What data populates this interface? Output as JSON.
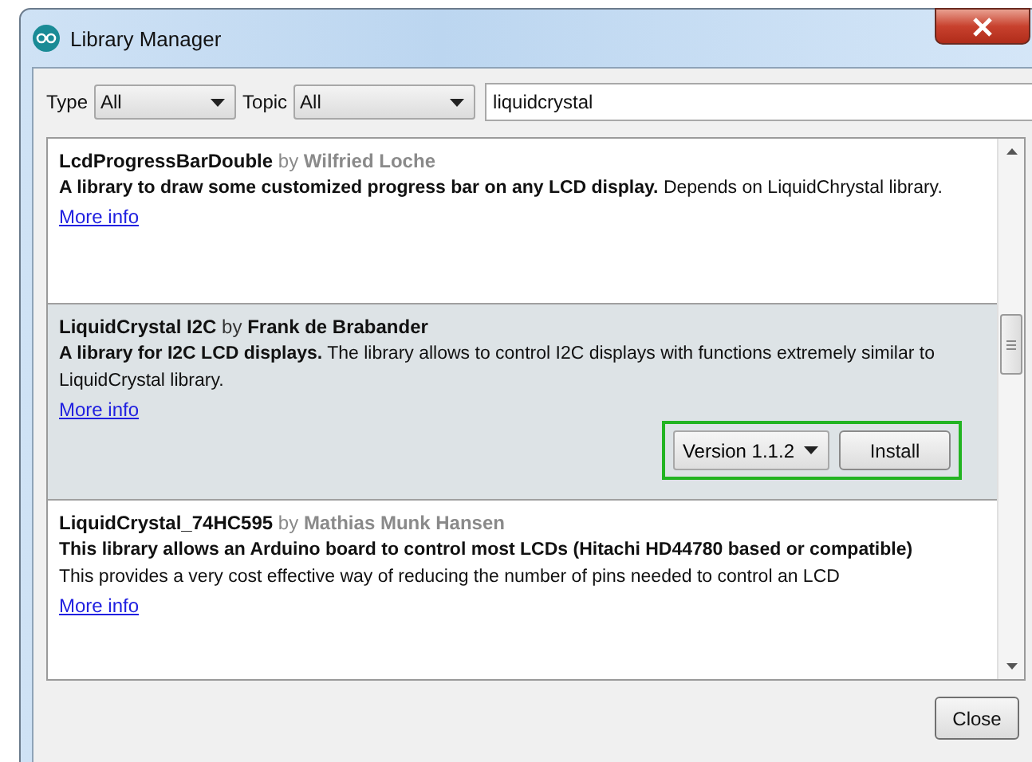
{
  "window": {
    "title": "Library Manager"
  },
  "filters": {
    "type_label": "Type",
    "type_value": "All",
    "topic_label": "Topic",
    "topic_value": "All",
    "search": {
      "value": "liquidcrystal"
    }
  },
  "libraries": [
    {
      "name": "LcdProgressBarDouble",
      "by": "by",
      "author": "Wilfried Loche",
      "description": [
        "**A library to draw some customized progress bar on any LCD display.** Depends on LiquidChrystal library."
      ],
      "more_info": "More info",
      "selected": false
    },
    {
      "name": "LiquidCrystal I2C",
      "by": "by",
      "author": "Frank de Brabander",
      "description": [
        "**A library for I2C LCD displays.** The library allows to control I2C displays with functions extremely similar to LiquidCrystal library."
      ],
      "more_info": "More info",
      "selected": true,
      "version": "Version 1.1.2",
      "install": "Install",
      "highlighted": true
    },
    {
      "name": "LiquidCrystal_74HC595",
      "by": "by",
      "author": "Mathias Munk Hansen",
      "description": [
        "**This library allows an Arduino board to control most LCDs (Hitachi HD44780 based or compatible)**",
        "This provides a very cost effective way of reducing the number of pins needed to control an LCD"
      ],
      "more_info": "More info",
      "selected": false
    }
  ],
  "close_button": "Close"
}
